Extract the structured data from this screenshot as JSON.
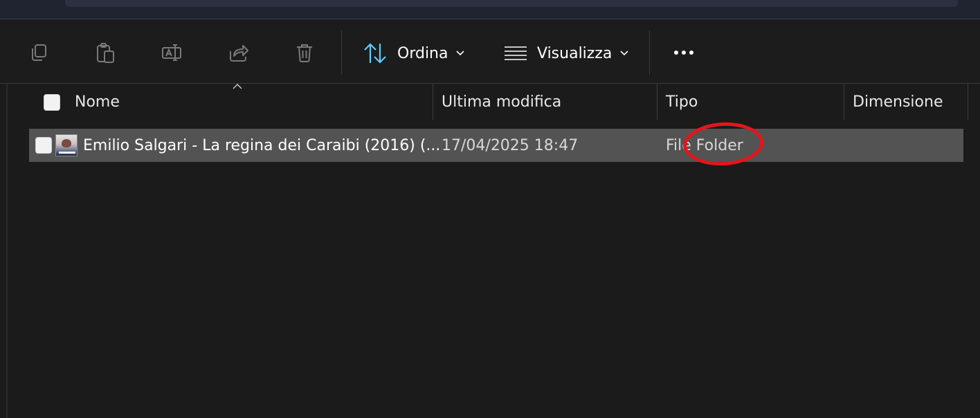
{
  "toolbar": {
    "buttons": [
      {
        "name": "copy-icon"
      },
      {
        "name": "paste-icon"
      },
      {
        "name": "rename-icon"
      },
      {
        "name": "share-icon"
      },
      {
        "name": "delete-icon"
      }
    ],
    "sort_label": "Ordina",
    "view_label": "Visualizza",
    "more_icon": "ellipsis-icon"
  },
  "columns": {
    "name": "Nome",
    "modified": "Ultima modifica",
    "type": "Tipo",
    "size": "Dimensione"
  },
  "rows": [
    {
      "name": "Emilio Salgari - La regina dei Caraibi (2016) (...",
      "modified": "17/04/2025 18:47",
      "type": "File Folder",
      "size": ""
    }
  ],
  "colors": {
    "background": "#1b1b1b",
    "selected_row": "#535353",
    "accent_icon": "#60cdff",
    "annotation": "#e3161b"
  }
}
